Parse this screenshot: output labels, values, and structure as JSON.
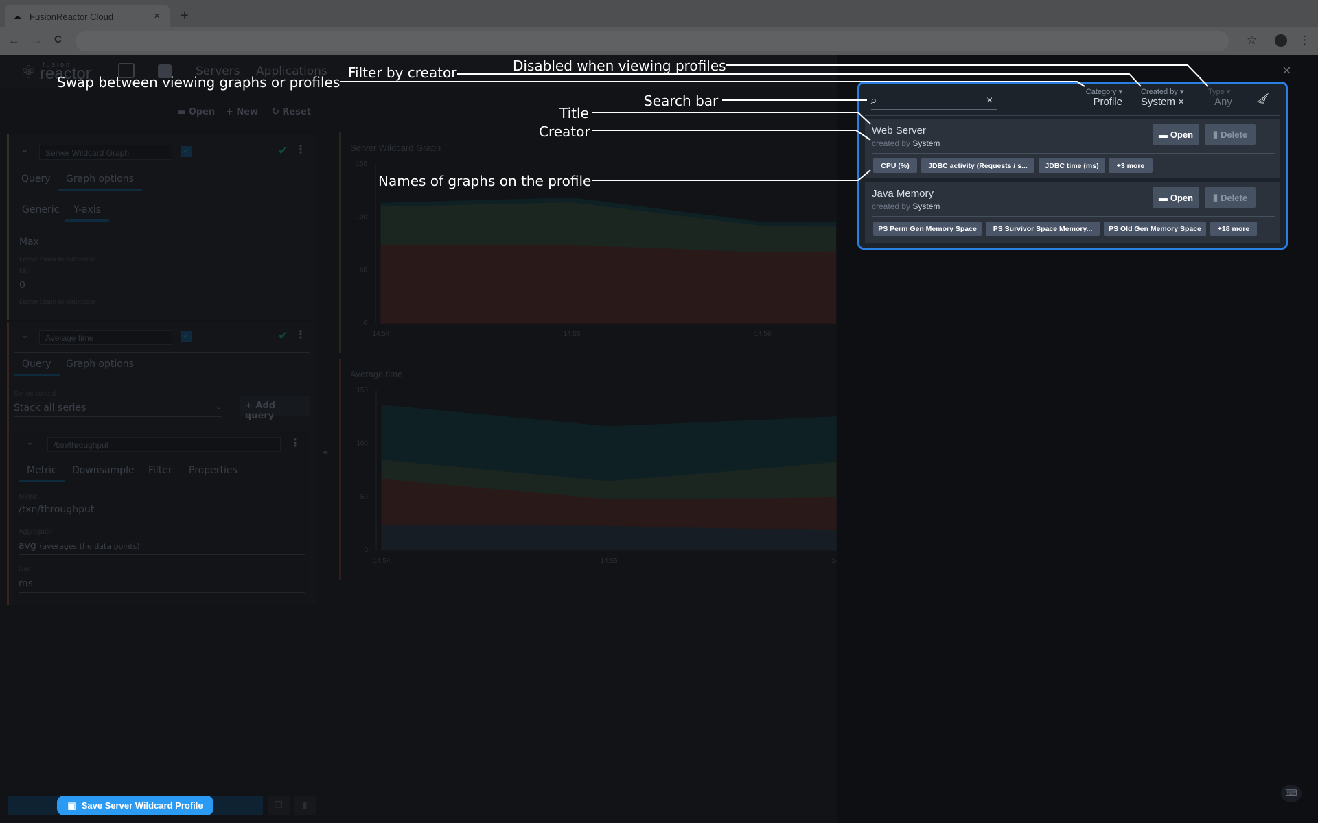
{
  "browser": {
    "tab_title": "FusionReactor Cloud",
    "close": "×",
    "new_tab": "+",
    "back": "←",
    "forward": "→",
    "reload": "C",
    "star": "☆",
    "menu": "⋮"
  },
  "app": {
    "logo_small": "fusion",
    "logo": "reactor",
    "nav": [
      "Servers",
      "Applications"
    ]
  },
  "toolbar": {
    "open": "Open",
    "new": "New",
    "reset": "Reset"
  },
  "graph1": {
    "name": "Server Wildcard Graph",
    "tabs": [
      "Query",
      "Graph options"
    ],
    "subtabs": [
      "Generic",
      "Y-axis"
    ],
    "max_label": "Max",
    "max_hint": "Leave blank to autoscale",
    "min_label": "Min",
    "min_value": "0",
    "min_hint": "Leave blank to autoscale"
  },
  "graph2": {
    "name": "Average time",
    "tabs": [
      "Query",
      "Graph options"
    ],
    "series_control_label": "Series control",
    "series_control_value": "Stack all series",
    "add_query": "Add query",
    "query": {
      "name": "/txn/throughput",
      "tabs": [
        "Metric",
        "Downsample",
        "Filter",
        "Properties"
      ],
      "metric_label": "Metric",
      "metric_value": "/txn/throughput",
      "aggregator_label": "Aggregator",
      "aggregator_value": "avg",
      "aggregator_desc": "(averages the data points)",
      "unit_label": "Unit",
      "unit_value": "ms"
    }
  },
  "collapse": "«",
  "save_button": "Save Server Wildcard Profile",
  "profiles_panel": {
    "search_placeholder": "",
    "filters": [
      {
        "label": "Category",
        "value": "Profile"
      },
      {
        "label": "Created by",
        "value": "System",
        "clear": "×"
      },
      {
        "label": "Type",
        "value": "Any",
        "disabled": true
      }
    ],
    "close": "×",
    "profiles": [
      {
        "title": "Web Server",
        "created_by_prefix": "created by",
        "creator": "System",
        "open": "Open",
        "delete": "Delete",
        "graphs": [
          "CPU (%)",
          "JDBC activity (Requests / s...",
          "JDBC time (ms)",
          "+3 more"
        ]
      },
      {
        "title": "Java Memory",
        "created_by_prefix": "created by",
        "creator": "System",
        "open": "Open",
        "delete": "Delete",
        "graphs": [
          "PS Perm Gen Memory Space",
          "PS Survivor Space Memory...",
          "PS Old Gen Memory Space",
          "+18 more"
        ]
      }
    ]
  },
  "annotations": {
    "disabled": "Disabled when viewing profiles",
    "filter_creator": "Filter by creator",
    "swap": "Swap between viewing graphs or profiles",
    "search": "Search bar",
    "title": "Title",
    "creator": "Creator",
    "graph_names": "Names of graphs on the profile"
  },
  "colors": {
    "accent": "#2b7fe0",
    "save_button": "#2b9af3",
    "series": [
      "#2c1a1a",
      "#1e2820",
      "#0f2024",
      "#161d24"
    ]
  },
  "chart_data": [
    {
      "type": "area",
      "title": "Server Wildcard Graph",
      "ylim": [
        0,
        150
      ],
      "yticks": [
        0,
        50,
        100,
        150
      ],
      "xticks": [
        "14:54",
        "14:55",
        "14:56"
      ],
      "stacked": true,
      "x": [
        "14:54:00",
        "14:55:00",
        "14:56:00",
        "14:56:23"
      ],
      "series": [
        {
          "values": [
            74,
            74,
            67,
            68
          ]
        },
        {
          "values": [
            36,
            40,
            25,
            23
          ]
        },
        {
          "values": [
            3,
            4,
            3,
            4
          ]
        }
      ]
    },
    {
      "type": "area",
      "title": "Average time",
      "ylim": [
        0,
        150
      ],
      "yticks": [
        0,
        50,
        100,
        150
      ],
      "xticks": [
        "14:54",
        "14:55",
        "14:"
      ],
      "stacked": true,
      "x": [
        "14:54:00",
        "14:55:00",
        "14:55:41",
        "14:56:00"
      ],
      "series": [
        {
          "values": [
            24,
            23,
            20,
            19
          ]
        },
        {
          "values": [
            43,
            25,
            29,
            31
          ]
        },
        {
          "values": [
            18,
            17,
            28,
            33
          ]
        },
        {
          "values": [
            51,
            51,
            45,
            42
          ]
        }
      ]
    }
  ]
}
